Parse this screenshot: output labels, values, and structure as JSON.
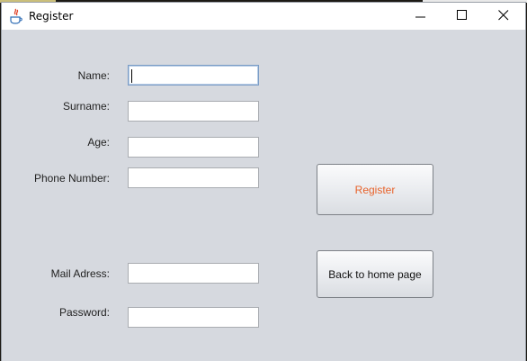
{
  "window": {
    "title": "Register",
    "controls": {
      "minimize_icon": "minimize-icon",
      "maximize_icon": "maximize-icon",
      "close_icon": "close-icon"
    }
  },
  "form": {
    "fields": [
      {
        "label": "Name:",
        "value": "",
        "focused": true
      },
      {
        "label": "Surname:",
        "value": ""
      },
      {
        "label": "Age:",
        "value": ""
      },
      {
        "label": "Phone Number:",
        "value": ""
      },
      {
        "label": "Mail Adress:",
        "value": ""
      },
      {
        "label": "Password:",
        "value": ""
      }
    ]
  },
  "buttons": {
    "register_label": "Register",
    "back_label": "Back to home page"
  },
  "colors": {
    "background": "#d6d9df",
    "register_text": "#e8622a",
    "focus_border": "#7a9cc6"
  }
}
